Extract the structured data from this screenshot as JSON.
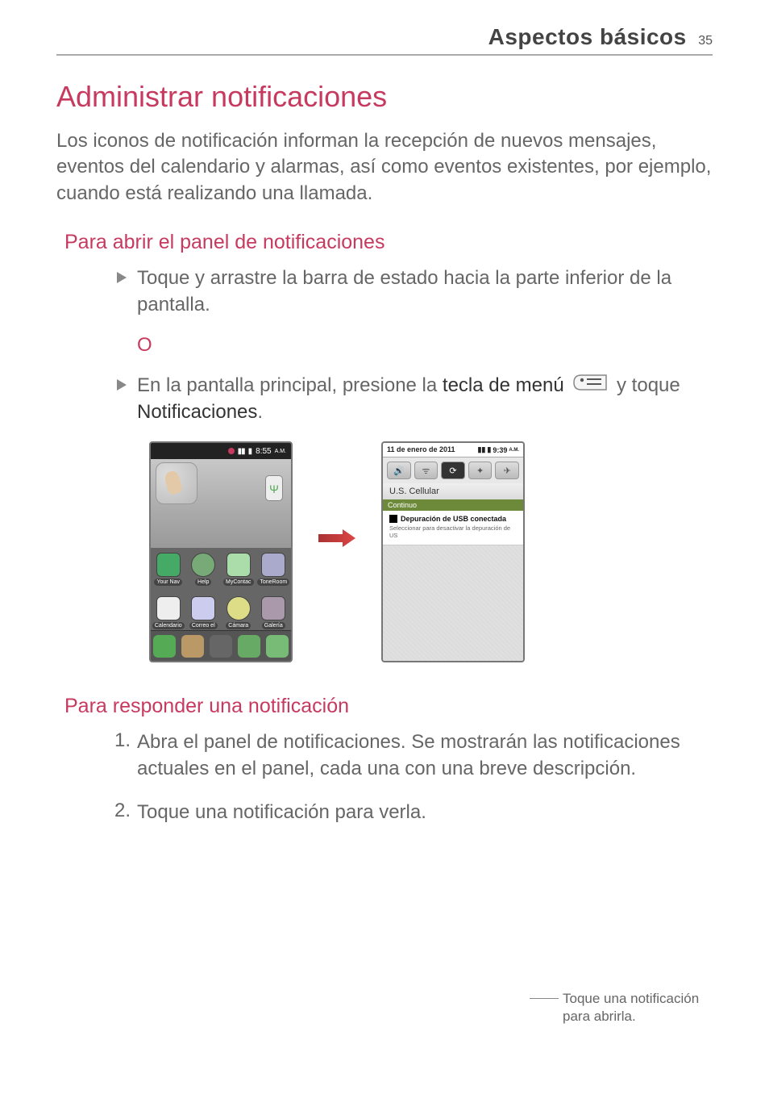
{
  "header": {
    "section_title": "Aspectos básicos",
    "page_number": "35"
  },
  "h1": "Administrar notificaciones",
  "intro": "Los iconos de notificación informan la recepción de nuevos mensajes, eventos del calendario y alarmas, así como eventos existentes, por ejemplo, cuando está realizando una llamada.",
  "sec1": {
    "title": "Para abrir el panel de notificaciones",
    "b1": "Toque y arrastre la barra de estado hacia la parte inferior de la pantalla.",
    "sep": "O",
    "b2a": "En la pantalla principal, presione la ",
    "b2b": "tecla de menú",
    "b2c": " y toque ",
    "b2d": "Notificaciones",
    "b2e": "."
  },
  "phoneA": {
    "status_time": "8:55",
    "status_ampm": "A.M.",
    "apps": [
      "Your Nav",
      "Help",
      "MyContac",
      "ToneRoom",
      "Calendario",
      "Correo el",
      "Cámara",
      "Galería"
    ]
  },
  "phoneB": {
    "title_date": "11 de enero de 2011",
    "title_time": "9:39",
    "title_ampm": "A.M.",
    "toggles_icons": [
      "sound-icon",
      "wifi-icon",
      "sync-icon",
      "gps-icon",
      "airplane-icon"
    ],
    "carrier": "U.S. Cellular",
    "continuo": "Continuo",
    "notif_title": "Depuración de USB conectada",
    "notif_sub": "Seleccionar para desactivar la depuración de US"
  },
  "callout": "Toque una notificación para abrirla.",
  "sec2": {
    "title": "Para responder una notificación",
    "n1": "Abra el panel de notificaciones. Se mostrarán las notificaciones actuales en el panel, cada una con una breve descripción.",
    "n2": "Toque una notificación para verla."
  }
}
